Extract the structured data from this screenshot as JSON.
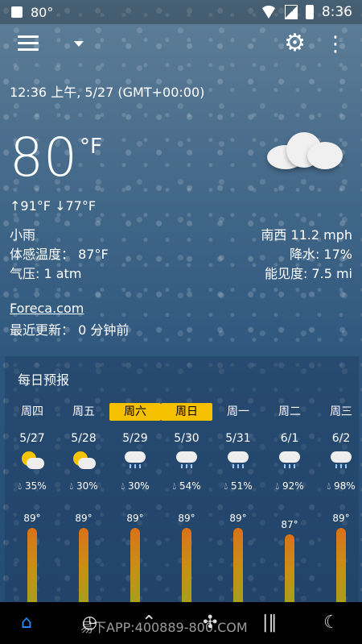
{
  "status": {
    "degree": "80°",
    "time": "8:36"
  },
  "header": {
    "datetime": "12:36 上午, 5/27 (GMT+00:00)"
  },
  "current": {
    "temp": "80",
    "unit": "°F",
    "hi": "↑91°F",
    "lo": "↓77°F",
    "condition": "小雨",
    "feels_like": "体感温度： 87°F",
    "pressure": "气压: 1 atm",
    "wind": "南西 11.2 mph",
    "precip": "降水: 17%",
    "visibility": "能见度: 7.5 mi",
    "provider": "Foreca.com",
    "updated": "最近更新： 0 分钟前"
  },
  "forecast": {
    "title": "每日预报",
    "days": [
      {
        "name": "周四",
        "date": "5/27",
        "pop": "35%",
        "temp": "89°",
        "icon": "partly-sunny-icon",
        "hl": false,
        "level": 0.93
      },
      {
        "name": "周五",
        "date": "5/28",
        "pop": "30%",
        "temp": "89°",
        "icon": "partly-sunny-icon",
        "hl": false,
        "level": 0.93
      },
      {
        "name": "周六",
        "date": "5/29",
        "pop": "30%",
        "temp": "89°",
        "icon": "cloud-rain-icon",
        "hl": true,
        "level": 0.93
      },
      {
        "name": "周日",
        "date": "5/30",
        "pop": "54%",
        "temp": "89°",
        "icon": "cloud-rain-icon",
        "hl": true,
        "level": 0.93
      },
      {
        "name": "周一",
        "date": "5/31",
        "pop": "51%",
        "temp": "89°",
        "icon": "cloud-rain-icon",
        "hl": false,
        "level": 0.93
      },
      {
        "name": "周二",
        "date": "6/1",
        "pop": "92%",
        "temp": "87°",
        "icon": "cloud-rain-icon",
        "hl": false,
        "level": 0.68
      },
      {
        "name": "周三",
        "date": "6/2",
        "pop": "98%",
        "temp": "89°",
        "icon": "cloud-rain-icon",
        "hl": false,
        "level": 0.93
      }
    ]
  },
  "nav": {
    "home_icon": "home-icon",
    "watermark": "易下APP:400889-800.COM"
  }
}
